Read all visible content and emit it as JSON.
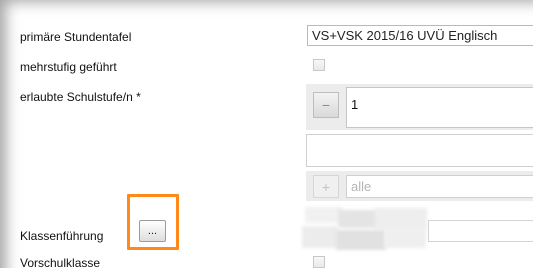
{
  "form": {
    "primary_schedule": {
      "label": "primäre Stundentafel",
      "value": "VS+VSK 2015/16 UVÜ Englisch"
    },
    "multi_level": {
      "label": "mehrstufig geführt",
      "checked": false
    },
    "allowed_levels": {
      "label": "erlaubte Schulstufe/n *",
      "remove_button": "−",
      "selected_value": "1",
      "add_button": "+",
      "add_placeholder": "alle"
    },
    "class_management": {
      "label": "Klassenführung",
      "button_label": "..."
    },
    "preschool_class": {
      "label": "Vorschulklasse",
      "checked": false
    }
  },
  "colors": {
    "highlight": "#ff8a1a",
    "field_border": "#b9b9b9",
    "panel_grey": "#ececec"
  }
}
